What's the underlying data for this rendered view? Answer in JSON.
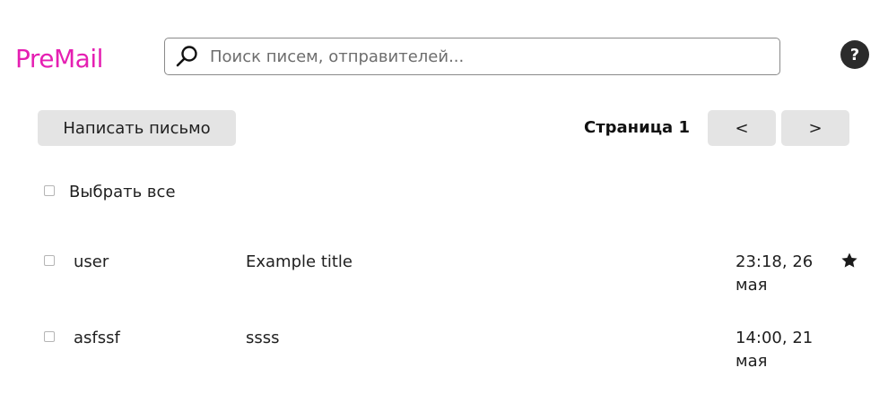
{
  "app": {
    "logo": "PreMail"
  },
  "colors": {
    "accent": "#e51fb2"
  },
  "search": {
    "placeholder": "Поиск писем, отправителей...",
    "value": "",
    "icon": "search-icon"
  },
  "help": {
    "label": "?",
    "icon": "help-icon"
  },
  "toolbar": {
    "compose_label": "Написать письмо",
    "page_label": "Страница 1",
    "prev_label": "<",
    "next_label": ">"
  },
  "select_all": {
    "label": "Выбрать все",
    "checked": false
  },
  "emails": [
    {
      "sender": "user",
      "subject": "Example title",
      "date": "23:18, 26 мая",
      "starred": true,
      "checked": false
    },
    {
      "sender": "asfssf",
      "subject": "ssss",
      "date": "14:00, 21 мая",
      "starred": false,
      "checked": false
    }
  ]
}
